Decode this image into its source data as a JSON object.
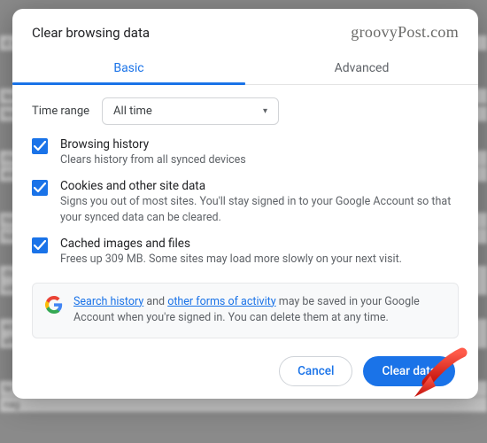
{
  "watermark": "groovyPost.com",
  "dialog": {
    "title": "Clear browsing data",
    "tabs": {
      "basic": "Basic",
      "advanced": "Advanced"
    },
    "timeRange": {
      "label": "Time range",
      "selected": "All time"
    },
    "options": [
      {
        "title": "Browsing history",
        "desc": "Clears history from all synced devices",
        "checked": true
      },
      {
        "title": "Cookies and other site data",
        "desc": "Signs you out of most sites. You'll stay signed in to your Google Account so that your synced data can be cleared.",
        "checked": true
      },
      {
        "title": "Cached images and files",
        "desc": "Frees up 309 MB. Some sites may load more slowly on your next visit.",
        "checked": true
      }
    ],
    "info": {
      "link1": "Search history",
      "mid1": " and ",
      "link2": "other forms of activity",
      "tail": " may be saved in your Google Account when you're signed in. You can delete them at any time."
    },
    "buttons": {
      "cancel": "Cancel",
      "confirm": "Clear data"
    }
  }
}
